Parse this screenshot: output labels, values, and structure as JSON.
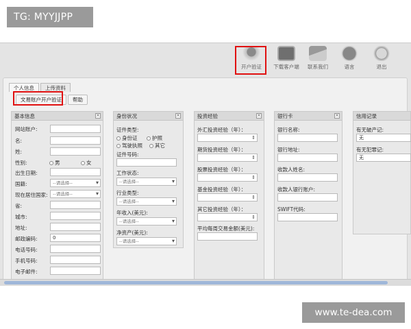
{
  "overlay": {
    "tg_label": "TG: MYYJJPP",
    "watermark": "www.te-dea.com"
  },
  "toolbar": {
    "items": [
      {
        "label": "开户验证",
        "icon": "user-verify-icon"
      },
      {
        "label": "下载客户端",
        "icon": "monitor-download-icon"
      },
      {
        "label": "联系我们",
        "icon": "envelope-icon"
      },
      {
        "label": "语言",
        "icon": "globe-icon"
      },
      {
        "label": "退出",
        "icon": "power-icon"
      }
    ]
  },
  "tabs": [
    "个人信息",
    "上传资料"
  ],
  "buttons": {
    "open_account": "文易账户开户验证",
    "help": "帮助"
  },
  "basic": {
    "title": "基本信息",
    "fields": [
      "网站账户:",
      "名:",
      "姓:",
      "性别:",
      "出生日期:",
      "国籍:",
      "现在居住国家:",
      "省:",
      "城市:",
      "地址:",
      "邮政编码:",
      "电话号码:",
      "手机号码:",
      "电子邮件:"
    ],
    "gender_male": "男",
    "gender_female": "女",
    "select_placeholder": "--请选择--",
    "postal_value": "0"
  },
  "identity": {
    "title": "身份状况",
    "doc_type_label": "证件类型:",
    "doc_types": [
      "身份证",
      "护照",
      "驾驶执照",
      "其它"
    ],
    "doc_no_label": "证件号码:",
    "work_label": "工作状态:",
    "industry_label": "行业类型:",
    "income_label": "年收入(美元):",
    "networth_label": "净资产(美元):",
    "select_placeholder": "--请选择--"
  },
  "experience": {
    "title": "投资经验",
    "fields": [
      "外汇投资经验（年）：",
      "期货投资经验（年）：",
      "股票投资经验（年）：",
      "基金投资经验（年）：",
      "其它投资经验（年）：",
      "平均每周交易金额(美元):"
    ]
  },
  "bank": {
    "title": "银行卡",
    "fields": [
      "银行名称:",
      "银行地址:",
      "收款人姓名:",
      "收款人银行账户:",
      "SWIFT代码:"
    ]
  },
  "credit": {
    "title": "信用记录",
    "fields": [
      "有无破产记:",
      "有无犯罪记:"
    ],
    "values": [
      "无",
      "无"
    ]
  },
  "colors": {
    "highlight": "#e01010",
    "panel": "#f1f1f1",
    "toolbar": "#e4e4e4"
  }
}
